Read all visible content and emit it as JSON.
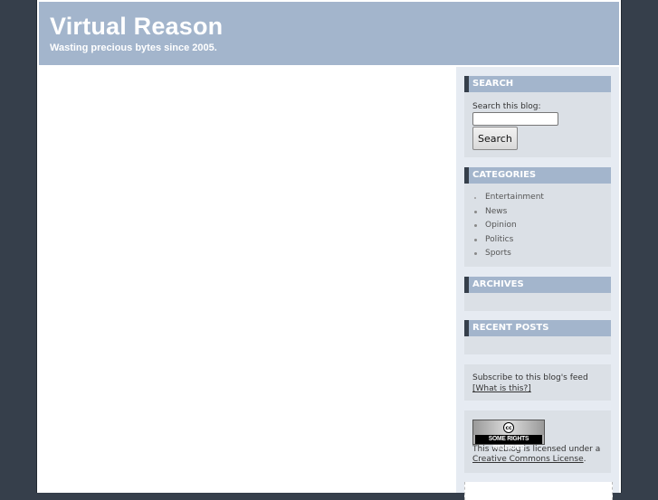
{
  "header": {
    "title": "Virtual Reason",
    "tagline": "Wasting precious bytes since 2005."
  },
  "sidebar": {
    "search": {
      "title": "SEARCH",
      "label": "Search this blog:",
      "input_value": "",
      "button_label": "Search"
    },
    "categories": {
      "title": "CATEGORIES",
      "items": [
        {
          "label": "Entertainment"
        },
        {
          "label": "News"
        },
        {
          "label": "Opinion"
        },
        {
          "label": "Politics"
        },
        {
          "label": "Sports"
        }
      ]
    },
    "archives": {
      "title": "ARCHIVES"
    },
    "recent_posts": {
      "title": "RECENT POSTS"
    },
    "feed": {
      "text": "Subscribe to this blog's feed",
      "link_label": "[What is this?]"
    },
    "license": {
      "badge_logo": "cc",
      "badge_text": "SOME RIGHTS RESERVED",
      "text": "This weblog is licensed under a",
      "link_label": "Creative Commons License",
      "suffix": "."
    }
  },
  "colors": {
    "background": "#363f4b",
    "header": "#a3b5cc",
    "widget": "#dbe0e6",
    "sidebar": "#e6ebf2"
  }
}
